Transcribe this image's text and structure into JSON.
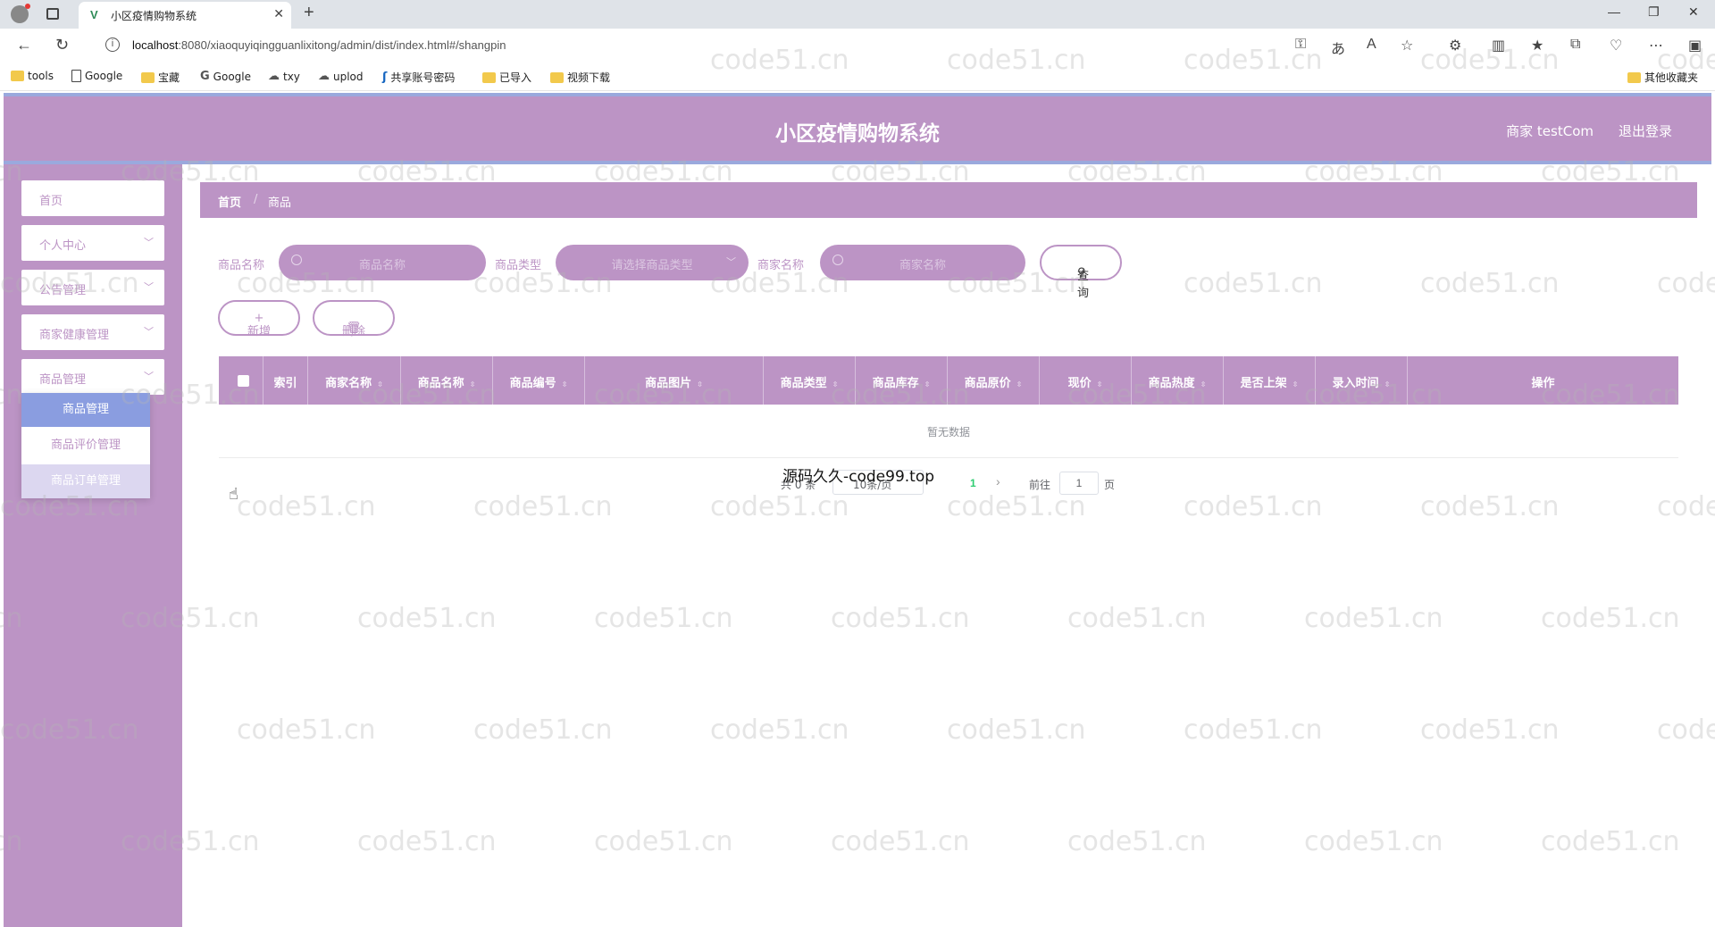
{
  "browser": {
    "tab_title": "小区疫情购物系统",
    "url_host": "localhost",
    "url_rest": ":8080/xiaoquyiqingguanlixitong/admin/dist/index.html#/shangpin",
    "bookmarks": [
      "tools",
      "Google",
      "宝藏",
      "Google",
      "txy",
      "uplod",
      "共享账号密码",
      "已导入",
      "视频下载"
    ],
    "other_bookmarks": "其他收藏夹"
  },
  "header": {
    "title": "小区疫情购物系统",
    "user": "商家 testCom",
    "logout": "退出登录"
  },
  "sidebar": {
    "items": [
      {
        "label": "首页"
      },
      {
        "label": "个人中心"
      },
      {
        "label": "公告管理"
      },
      {
        "label": "商家健康管理"
      },
      {
        "label": "商品管理"
      }
    ],
    "submenu": [
      {
        "label": "商品管理"
      },
      {
        "label": "商品评价管理"
      },
      {
        "label": "商品订单管理"
      }
    ]
  },
  "breadcrumb": {
    "home": "首页",
    "separator": "/",
    "current": "商品"
  },
  "filters": {
    "name_label": "商品名称",
    "name_placeholder": "商品名称",
    "type_label": "商品类型",
    "type_placeholder": "请选择商品类型",
    "shop_label": "商家名称",
    "shop_placeholder": "商家名称",
    "query_button": "查询"
  },
  "actions": {
    "add": "新增",
    "delete": "删除"
  },
  "table": {
    "columns": [
      "索引",
      "商家名称",
      "商品名称",
      "商品编号",
      "商品图片",
      "商品类型",
      "商品库存",
      "商品原价",
      "现价",
      "商品热度",
      "是否上架",
      "录入时间",
      "操作"
    ],
    "empty_text": "暂无数据"
  },
  "pagination": {
    "total": "共 0 条",
    "page_size": "10条/页",
    "current_page": "1",
    "goto_label": "前往",
    "goto_value": "1",
    "page_suffix": "页"
  },
  "watermarks": {
    "overlay": "源码久久-code99.top",
    "tile": "code51.cn"
  },
  "colors": {
    "primary": "#bc94c5",
    "accent": "#8a9de0"
  }
}
